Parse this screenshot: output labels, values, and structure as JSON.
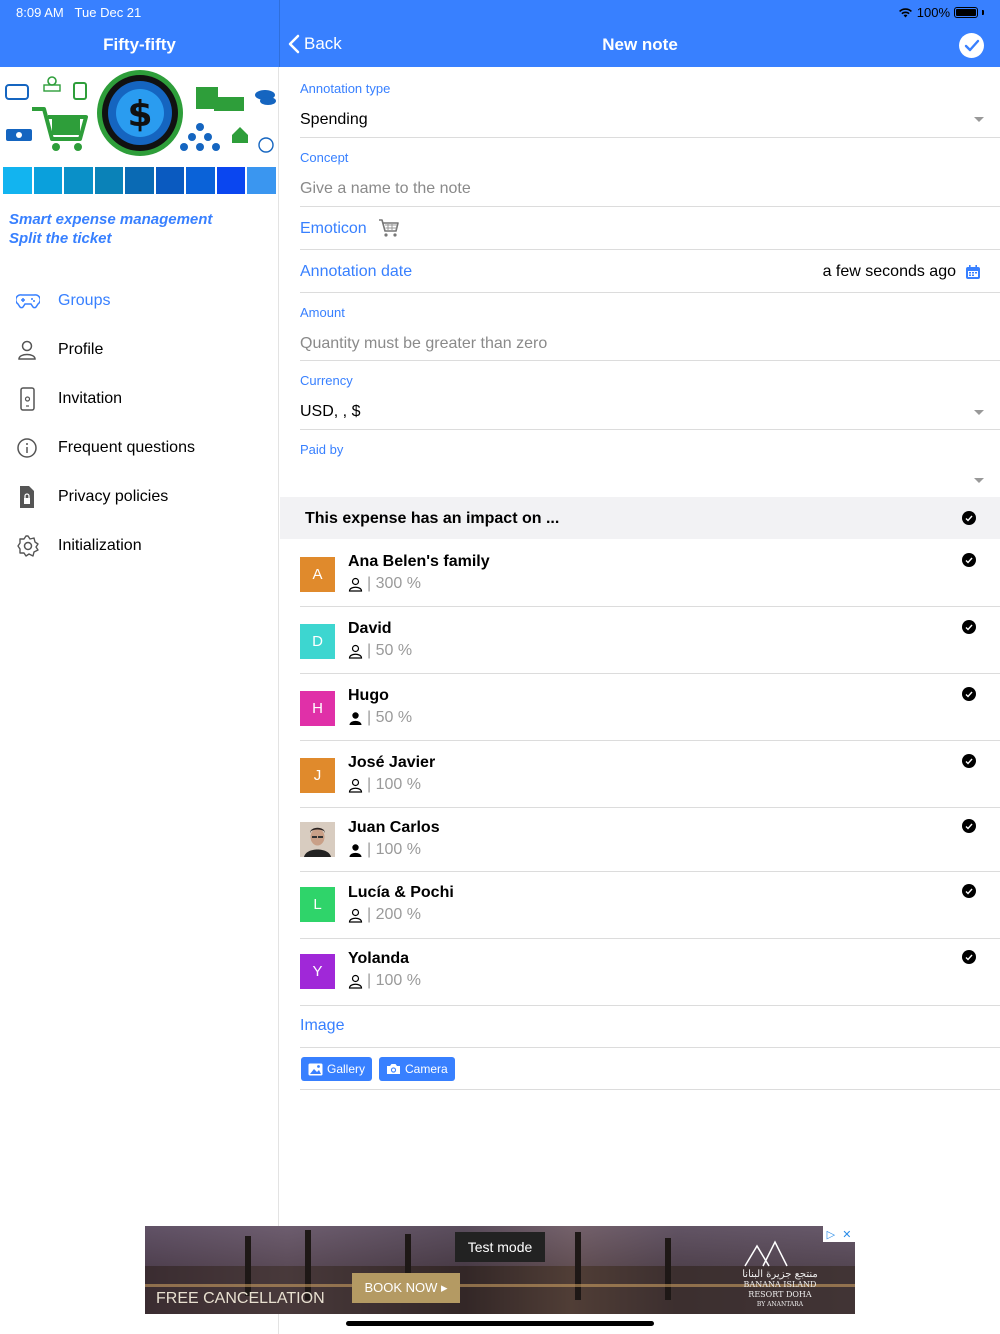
{
  "status_bar": {
    "time": "8:09 AM",
    "date": "Tue Dec 21",
    "battery": "100%"
  },
  "sidebar": {
    "app_title": "Fifty-fifty",
    "tagline_1": "Smart expense management",
    "tagline_2": "Split the ticket",
    "color_strip": [
      "#12b4f0",
      "#0aa0dc",
      "#0a90c8",
      "#0a82b8",
      "#0a6ab4",
      "#0a5ac0",
      "#0a62d8",
      "#0a46f0",
      "#3a96f0"
    ],
    "menu": [
      {
        "label": "Groups",
        "icon": "gamepad-icon",
        "active": true
      },
      {
        "label": "Profile",
        "icon": "person-icon",
        "active": false
      },
      {
        "label": "Invitation",
        "icon": "phone-icon",
        "active": false
      },
      {
        "label": "Frequent questions",
        "icon": "info-icon",
        "active": false
      },
      {
        "label": "Privacy policies",
        "icon": "document-lock-icon",
        "active": false
      },
      {
        "label": "Initialization",
        "icon": "gear-icon",
        "active": false
      }
    ]
  },
  "header": {
    "back_label": "Back",
    "title": "New note"
  },
  "form": {
    "annotation_type": {
      "label": "Annotation type",
      "value": "Spending"
    },
    "concept": {
      "label": "Concept",
      "placeholder": "Give a name to the note"
    },
    "emoticon": {
      "label": "Emoticon",
      "value": "🛒"
    },
    "annotation_date": {
      "label": "Annotation date",
      "value": "a few seconds ago"
    },
    "amount": {
      "label": "Amount",
      "placeholder": "Quantity must be greater than zero"
    },
    "currency": {
      "label": "Currency",
      "value": "USD, , $"
    },
    "paid_by": {
      "label": "Paid by",
      "value": ""
    }
  },
  "impact": {
    "title": "This expense has an impact on ...",
    "members": [
      {
        "initial": "A",
        "name": "Ana Belen's family",
        "share": "| 300 %",
        "color": "#e08a2c",
        "icon": "person-outline-icon"
      },
      {
        "initial": "D",
        "name": "David",
        "share": "| 50 %",
        "color": "#3dd6d0",
        "icon": "person-outline-icon"
      },
      {
        "initial": "H",
        "name": "Hugo",
        "share": "| 50 %",
        "color": "#e030a8",
        "icon": "person-filled-icon"
      },
      {
        "initial": "J",
        "name": "José Javier",
        "share": "| 100 %",
        "color": "#e08a2c",
        "icon": "person-outline-icon"
      },
      {
        "initial": "",
        "name": "Juan Carlos",
        "share": "| 100 %",
        "color": "#c9b8a8",
        "icon": "person-filled-icon",
        "photo": true
      },
      {
        "initial": "L",
        "name": "Lucía & Pochi",
        "share": "| 200 %",
        "color": "#2fd46a",
        "icon": "person-outline-icon"
      },
      {
        "initial": "Y",
        "name": "Yolanda",
        "share": "| 100 %",
        "color": "#a028d8",
        "icon": "person-outline-icon"
      }
    ]
  },
  "image_section": {
    "label": "Image",
    "gallery_label": "Gallery",
    "camera_label": "Camera"
  },
  "ad": {
    "badge": "Test mode",
    "headline": "FREE CANCELLATION",
    "cta": "BOOK NOW ▸",
    "brand_ar": "منتجع جزيرة البنانا",
    "brand_line1": "BANANA ISLAND",
    "brand_line2": "RESORT DOHA",
    "brand_line3": "BY ANANTARA"
  }
}
